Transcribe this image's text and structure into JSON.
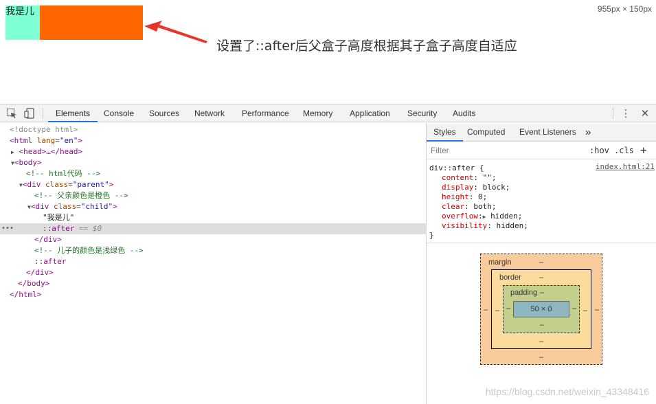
{
  "page": {
    "child_text": "我是儿",
    "viewport_size": "955px × 150px",
    "annotation": "设置了::after后父盒子高度根据其子盒子高度自适应",
    "colors": {
      "child": "#7fffd4",
      "parent": "#ff6600",
      "arrow": "#e8342a"
    }
  },
  "devtools": {
    "tabs": [
      "Elements",
      "Console",
      "Sources",
      "Network",
      "Performance",
      "Memory",
      "Application",
      "Security",
      "Audits"
    ],
    "active_tab": "Elements",
    "icons": [
      "inspect-element-icon",
      "device-toolbar-icon",
      "more-options-icon",
      "close-icon"
    ]
  },
  "dom": {
    "doctype": "<!doctype html>",
    "html_open": "<html",
    "lang_attr": "lang",
    "lang_val": "\"en\"",
    "head": "<head>…</head>",
    "body_open": "<body>",
    "comment_html": "<!-- html代码 -->",
    "div_open": "<div",
    "class_attr": "class",
    "parent_val": "\"parent\"",
    "comment_parent": "<!-- 父亲颜色是橙色 -->",
    "child_val": "\"child\"",
    "child_text": "\"我是儿\"",
    "after": "::after",
    "selected_marker": "== $0",
    "div_close": "</div>",
    "comment_child": "<!-- 儿子的颜色是浅绿色 -->",
    "body_close": "</body>",
    "html_close": "</html>"
  },
  "styles": {
    "tabs": [
      "Styles",
      "Computed",
      "Event Listeners"
    ],
    "more": "»",
    "filter_placeholder": "Filter",
    "hov": ":hov",
    "cls": ".cls",
    "add": "+",
    "selector": "div::after {",
    "source": "index.html:21",
    "props": [
      {
        "name": "content",
        "value": "\"\";"
      },
      {
        "name": "display",
        "value": "block;"
      },
      {
        "name": "height",
        "value": "0;"
      },
      {
        "name": "clear",
        "value": "both;"
      },
      {
        "name": "overflow",
        "value": "hidden;"
      },
      {
        "name": "visibility",
        "value": "hidden;"
      }
    ],
    "close_brace": "}"
  },
  "box_model": {
    "margin_label": "margin",
    "border_label": "border",
    "padding_label": "padding",
    "content": "50 × 0",
    "dash": "–"
  },
  "watermark": "https://blog.csdn.net/weixin_43348416"
}
